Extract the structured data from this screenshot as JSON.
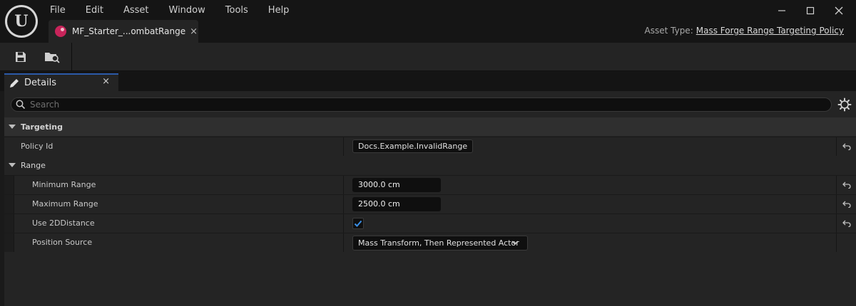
{
  "menu": [
    "File",
    "Edit",
    "Asset",
    "Window",
    "Tools",
    "Help"
  ],
  "asset_tab": {
    "label": "MF_Starter_...ombatRange",
    "close": "×"
  },
  "asset_type": {
    "label": "Asset Type:",
    "value": "Mass Forge Range Targeting Policy"
  },
  "details_tab": {
    "label": "Details",
    "close": "×"
  },
  "search": {
    "placeholder": "Search",
    "value": ""
  },
  "categories": {
    "targeting": "Targeting",
    "range": "Range"
  },
  "properties": {
    "policy_id": {
      "name": "Policy Id",
      "value": "Docs.Example.InvalidRange"
    },
    "min_range": {
      "name": "Minimum Range",
      "value": "3000.0 cm"
    },
    "max_range": {
      "name": "Maximum Range",
      "value": "2500.0 cm"
    },
    "use_2d": {
      "name": "Use 2DDistance",
      "checked": true
    },
    "position_source": {
      "name": "Position Source",
      "value": "Mass Transform, Then Represented Actor"
    }
  },
  "colors": {
    "accent": "#2b5aa8",
    "checkbox_check": "#3a8fe6",
    "asset_icon": "#c8245a"
  }
}
